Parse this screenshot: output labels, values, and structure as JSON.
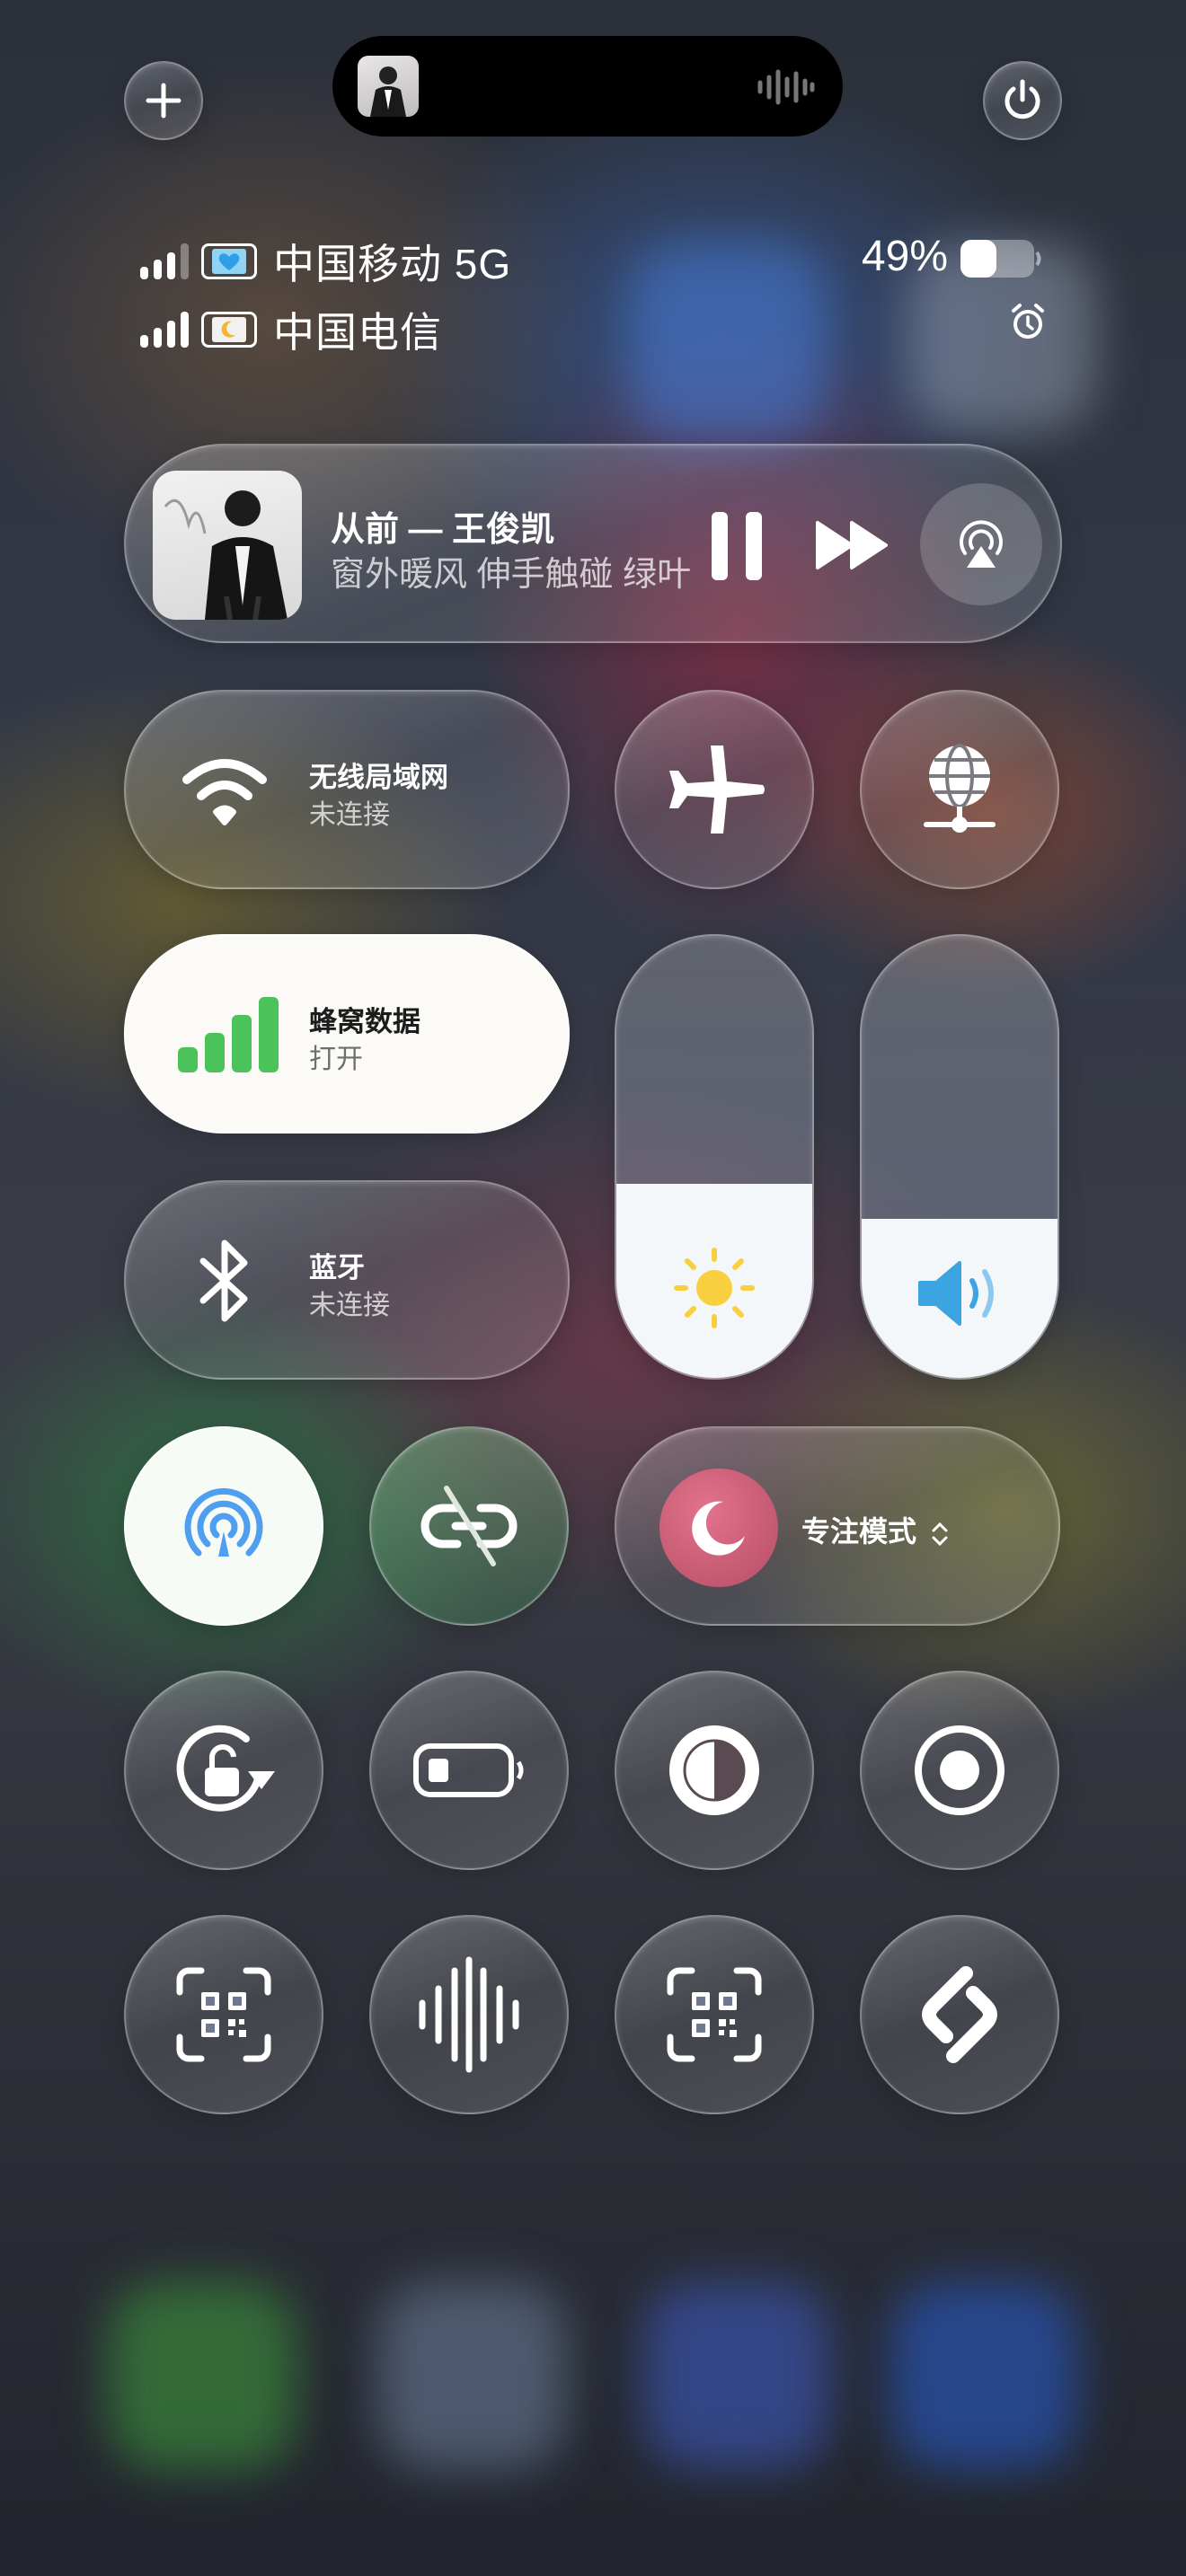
{
  "status": {
    "carrier_1": "中国移动 5G",
    "carrier_2": "中国电信",
    "battery_percent": "49%",
    "battery_level": 0.49,
    "sim_1_icon": "heart-icon",
    "sim_2_icon": "moon-icon"
  },
  "now_playing": {
    "title": "从前 — 王俊凯",
    "lyric": "窗外暖风 伸手触碰 绿叶"
  },
  "tiles": {
    "wifi": {
      "label": "无线局域网",
      "status": "未连接"
    },
    "cellular": {
      "label": "蜂窝数据",
      "status": "打开"
    },
    "bluetooth": {
      "label": "蓝牙",
      "status": "未连接"
    },
    "focus": {
      "label": "专注模式",
      "chevron": "⌃⌄"
    }
  },
  "sliders": {
    "brightness_level": 0.44,
    "volume_level": 0.36
  },
  "colors": {
    "cellular_green": "#4cc35a",
    "airdrop_blue": "#4f9ef0",
    "brightness_yellow": "#f8cf3e",
    "volume_blue": "#3da4e2",
    "focus_pink": "#d2607a"
  }
}
